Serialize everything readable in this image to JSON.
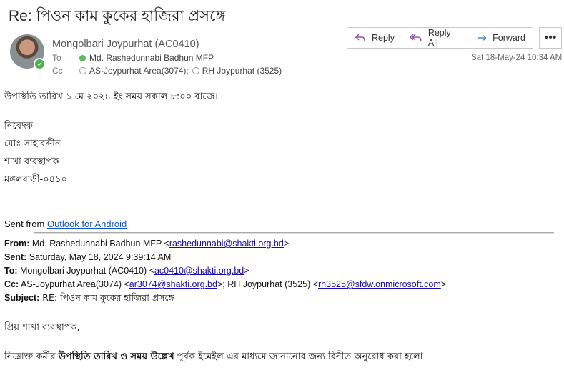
{
  "email": {
    "subject": "Re: পিওন কাম কুকের হাজিরা প্রসঙ্গে",
    "sender": "Mongolbari Joypurhat (AC0410)",
    "to_label": "To",
    "to_recipient": "Md. Rashedunnabi Badhun MFP",
    "cc_label": "Cc",
    "cc_recipient_1": "AS-Joypurhat Area(3074);",
    "cc_recipient_2": "RH Joypurhat (3525)",
    "date": "Sat 18-May-24 10:34 AM"
  },
  "toolbar": {
    "reply": "Reply",
    "reply_all": "Reply All",
    "forward": "Forward",
    "more": "•••"
  },
  "body": {
    "line1": "উপস্থিতি তারিখ ১ মে ২০২৪ ইং সময় সকাল ৮:০০ বাজে।",
    "sig1": "নিবেদক",
    "sig2": "মোঃ সাহাবদ্দীন",
    "sig3": "শাখা ব্যবস্থাপক",
    "sig4": "মঙ্গলবাড়ী-০৪১০",
    "sent_from": "Sent from ",
    "sent_from_link": "Outlook for Android"
  },
  "quoted": {
    "from_label": "From:",
    "from_name": " Md. Rashedunnabi Badhun MFP <",
    "from_email": "rashedunnabi@shakti.org.bd",
    "from_close": ">",
    "sent_label": "Sent:",
    "sent_value": " Saturday, May 18, 2024 9:39:14 AM",
    "to_label": "To:",
    "to_name": " Mongolbari Joypurhat (AC0410) <",
    "to_email": "ac0410@shakti.org.bd",
    "to_close": ">",
    "cc_label": "Cc:",
    "cc_name1": " AS-Joypurhat Area(3074) <",
    "cc_email1": "ar3074@shakti.org.bd",
    "cc_mid": ">; RH Joypurhat (3525) <",
    "cc_email2": "rh3525@sfdw.onmicrosoft.com",
    "cc_close": ">",
    "subject_label": "Subject:",
    "subject_value": " RE: পিওন কাম কুকের হাজিরা প্রসঙ্গে",
    "greeting": "প্রিয় শাখা ব্যবস্থাপক,",
    "para_start": "নিম্নোক্ত কর্মীর ",
    "para_bold": "উপস্থিতি তারিখ ও সময় উল্লেখ",
    "para_end": " পূর্বক ইমেইল এর মাধ্যমে জানানোর জন্য বিনীত অনুরোধ করা হলো।"
  },
  "colors": {
    "accent": "#0078d4",
    "link": "#1a0dab",
    "presence": "#4caf50"
  }
}
